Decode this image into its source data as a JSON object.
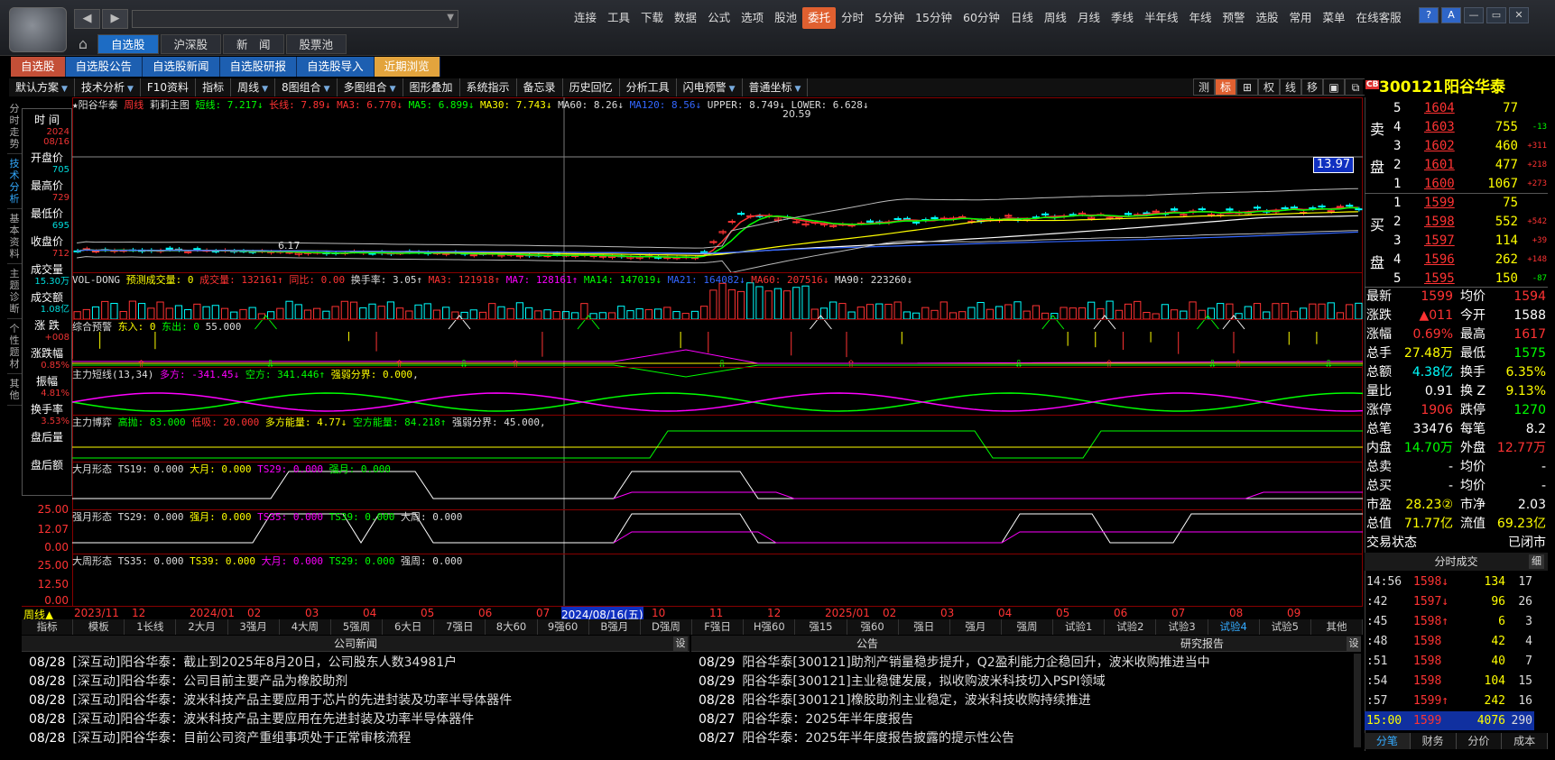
{
  "app": {
    "menu": [
      "连接",
      "工具",
      "下载",
      "数据",
      "公式",
      "选项",
      "股池",
      "委托",
      "分时",
      "5分钟",
      "15分钟",
      "60分钟",
      "日线",
      "周线",
      "月线",
      "季线",
      "半年线",
      "年线",
      "预警",
      "选股",
      "常用",
      "菜单",
      "在线客服"
    ],
    "highlighted_menu": "委托",
    "top_tabs": [
      "自选股",
      "沪深股",
      "新　闻",
      "股票池"
    ],
    "window_buttons": [
      "?",
      "A",
      "—",
      "▭",
      "✕"
    ]
  },
  "sub_tabs": [
    "自选股",
    "自选股公告",
    "自选股新闻",
    "自选股研报",
    "自选股导入",
    "近期浏览"
  ],
  "toolbar": [
    "默认方案",
    "技术分析",
    "F10资料",
    "指标",
    "周线",
    "8图组合",
    "多图组合",
    "图形叠加",
    "系统指示",
    "备忘录",
    "历史回忆",
    "分析工具",
    "闪电预警",
    "普通坐标"
  ],
  "right_tools": [
    "测",
    "标",
    "⊞",
    "权",
    "线",
    "移",
    "▣",
    "⧉"
  ],
  "vtabs": [
    "分时走势",
    "技术分析",
    "基本资料",
    "主题诊断",
    "个性题材",
    "其他"
  ],
  "info_panel": [
    {
      "label": "时 间",
      "values": [
        "2024",
        "08/16"
      ],
      "cyan": false
    },
    {
      "label": "开盘价",
      "values": [
        "705"
      ],
      "cyan": true
    },
    {
      "label": "最高价",
      "values": [
        "729"
      ],
      "cyan": false
    },
    {
      "label": "最低价",
      "values": [
        "695"
      ],
      "cyan": true
    },
    {
      "label": "收盘价",
      "values": [
        "712"
      ],
      "cyan": false
    },
    {
      "label": "成交量",
      "values": [
        "15.30万"
      ],
      "cyan": true
    },
    {
      "label": "成交额",
      "values": [
        "1.08亿"
      ],
      "cyan": true
    },
    {
      "label": "涨 跌",
      "values": [
        "+008"
      ],
      "cyan": false
    },
    {
      "label": "涨跌幅",
      "values": [
        "0.85%"
      ],
      "cyan": false
    },
    {
      "label": "振幅",
      "values": [
        "4.81%"
      ],
      "cyan": false
    },
    {
      "label": "换手率",
      "values": [
        "3.53%"
      ],
      "cyan": false
    },
    {
      "label": "盘后量",
      "values": [
        ""
      ],
      "cyan": false
    },
    {
      "label": "盘后额",
      "values": [
        ""
      ],
      "cyan": false
    }
  ],
  "panes": {
    "main": {
      "parts": [
        [
          "★阳谷华泰",
          "w"
        ],
        [
          " 周线 ",
          "r"
        ],
        [
          "莉莉主图 ",
          "w"
        ],
        [
          "短线: 7.217↓",
          "g"
        ],
        [
          " 长线: 7.89↓",
          "r"
        ],
        [
          " MA3: 6.770↓",
          "r"
        ],
        [
          " MA5: 6.899↓",
          "g"
        ],
        [
          " MA30: 7.743↓",
          "y"
        ],
        [
          " MA60: 8.26↓",
          "w"
        ],
        [
          " MA120: 8.56↓",
          "b"
        ],
        [
          " UPPER: 8.749↓",
          "w"
        ],
        [
          " LOWER: 6.628↓",
          "w"
        ]
      ],
      "high_label": "20.59",
      "low_label": "6.17",
      "price_tag": "13.97"
    },
    "vol": {
      "parts": [
        [
          "VOL-DONG ",
          "w"
        ],
        [
          "预测成交量: 0",
          "y"
        ],
        [
          " 成交量: 132161↑",
          "r"
        ],
        [
          " 同比: 0.00",
          "r"
        ],
        [
          " 换手率: 3.05↑",
          "w"
        ],
        [
          " MA3: 121918↑",
          "r"
        ],
        [
          " MA7: 128161↑",
          "m"
        ],
        [
          " MA14: 147019↓",
          "g"
        ],
        [
          " MA21: 164082↓",
          "b"
        ],
        [
          " MA60: 207516↓",
          "r"
        ],
        [
          " MA90: 223260↓",
          "w"
        ]
      ]
    },
    "warn": {
      "parts": [
        [
          "综合预警 ",
          "w"
        ],
        [
          "东入: 0",
          "y"
        ],
        [
          " 东出: 0",
          "g"
        ],
        [
          " 55.000",
          "w"
        ]
      ]
    },
    "zlsd": {
      "parts": [
        [
          "主力短线(13,34) ",
          "w"
        ],
        [
          "多方: -341.45↓",
          "m"
        ],
        [
          " 空方: 341.446↑",
          "g"
        ],
        [
          " 强弱分界: 0.000",
          "y"
        ],
        [
          ",",
          "w"
        ]
      ]
    },
    "zlby": {
      "parts": [
        [
          "主力博弈 ",
          "w"
        ],
        [
          "高抛: 83.000",
          "g"
        ],
        [
          " 低吸: 20.000",
          "r"
        ],
        [
          " 多方能量: 4.77↓",
          "y"
        ],
        [
          " 空方能量: 84.218↑",
          "g"
        ],
        [
          " 强弱分界: 45.000",
          "w"
        ],
        [
          ",",
          "w"
        ]
      ]
    },
    "dyxt": {
      "parts": [
        [
          "大月形态 ",
          "w"
        ],
        [
          "TS19: 0.000",
          "w"
        ],
        [
          " 大月: 0.000",
          "y"
        ],
        [
          " TS29: 0.000",
          "m"
        ],
        [
          " 强月: 0.000",
          "g"
        ]
      ]
    },
    "qyxt": {
      "parts": [
        [
          "强月形态 ",
          "w"
        ],
        [
          "TS29: 0.000",
          "w"
        ],
        [
          " 强月: 0.000",
          "y"
        ],
        [
          " TS35: 0.000",
          "m"
        ],
        [
          " TS39: 0.000",
          "g"
        ],
        [
          " 大周: 0.000",
          "w"
        ]
      ]
    },
    "dzxt": {
      "parts": [
        [
          "大周形态 ",
          "w"
        ],
        [
          "TS35: 0.000",
          "w"
        ],
        [
          " TS39: 0.000",
          "y"
        ],
        [
          " 大月: 0.000",
          "m"
        ],
        [
          " TS29: 0.000",
          "g"
        ],
        [
          " 强周: 0.000",
          "w"
        ]
      ]
    }
  },
  "y_axis_labels": {
    "p1": [
      "25.00",
      "12.07",
      "0.00"
    ],
    "p2": [
      "25.00",
      "12.50",
      "0.00"
    ]
  },
  "time_axis": {
    "period": "周线▲",
    "labels": [
      "2023/11",
      "12",
      "2024/01",
      "02",
      "03",
      "04",
      "05",
      "06",
      "07",
      "08",
      "10",
      "11",
      "12",
      "2025/01",
      "02",
      "03",
      "04",
      "05",
      "06",
      "07",
      "08",
      "09"
    ],
    "cursor": "2024/08/16(五)"
  },
  "bottom_tabs": [
    "指标",
    "模板",
    "1长线",
    "2大月",
    "3强月",
    "4大周",
    "5强周",
    "6大日",
    "7强日",
    "8大60",
    "9强60",
    "B强月",
    "D强周",
    "F强日",
    "H强60",
    "强15",
    "强60",
    "强日",
    "强月",
    "强周",
    "试验1",
    "试验2",
    "试验3",
    "试验4",
    "试验5",
    "其他"
  ],
  "news": {
    "left_title": "公司新闻",
    "mid_title": "公告",
    "right_title": "研究报告",
    "set_label": "设",
    "left": [
      {
        "date": "08/28",
        "text": "[深互动]阳谷华泰：截止到2025年8月20日，公司股东人数34981户"
      },
      {
        "date": "08/28",
        "text": "[深互动]阳谷华泰：公司目前主要产品为橡胶助剂"
      },
      {
        "date": "08/28",
        "text": "[深互动]阳谷华泰：波米科技产品主要应用于芯片的先进封装及功率半导体器件"
      },
      {
        "date": "08/28",
        "text": "[深互动]阳谷华泰：波米科技产品主要应用在先进封装及功率半导体器件"
      },
      {
        "date": "08/28",
        "text": "[深互动]阳谷华泰：目前公司资产重组事项处于正常审核流程"
      }
    ],
    "right": [
      {
        "date": "08/29",
        "text": "阳谷华泰[300121]助剂产销量稳步提升，Q2盈利能力企稳回升，波米收购推进当中"
      },
      {
        "date": "08/29",
        "text": "阳谷华泰[300121]主业稳健发展，拟收购波米科技切入PSPI领域"
      },
      {
        "date": "08/28",
        "text": "阳谷华泰[300121]橡胶助剂主业稳定，波米科技收购持续推进"
      },
      {
        "date": "08/27",
        "text": "阳谷华泰：2025年半年度报告"
      },
      {
        "date": "08/27",
        "text": "阳谷华泰：2025年半年度报告披露的提示性公告"
      }
    ]
  },
  "stock": {
    "badge": "CB",
    "code": "300121",
    "name": "阳谷华泰"
  },
  "orderbook": {
    "sell_label": [
      "卖",
      "盘"
    ],
    "buy_label": [
      "买",
      "盘"
    ],
    "asks": [
      {
        "lv": "5",
        "price": "1604",
        "qty": "77",
        "delta": ""
      },
      {
        "lv": "4",
        "price": "1603",
        "qty": "755",
        "delta": "-13"
      },
      {
        "lv": "3",
        "price": "1602",
        "qty": "460",
        "delta": "+311"
      },
      {
        "lv": "2",
        "price": "1601",
        "qty": "477",
        "delta": "+218"
      },
      {
        "lv": "1",
        "price": "1600",
        "qty": "1067",
        "delta": "+273"
      }
    ],
    "bids": [
      {
        "lv": "1",
        "price": "1599",
        "qty": "75",
        "delta": ""
      },
      {
        "lv": "2",
        "price": "1598",
        "qty": "552",
        "delta": "+542"
      },
      {
        "lv": "3",
        "price": "1597",
        "qty": "114",
        "delta": "+39"
      },
      {
        "lv": "4",
        "price": "1596",
        "qty": "262",
        "delta": "+148"
      },
      {
        "lv": "5",
        "price": "1595",
        "qty": "150",
        "delta": "-87"
      }
    ]
  },
  "quotes": [
    {
      "k": "最新",
      "v": "1599",
      "vc": "#f33",
      "k2": "均价",
      "v2": "1594",
      "v2c": "#f33"
    },
    {
      "k": "涨跌",
      "v": "▲011",
      "vc": "#f33",
      "k2": "今开",
      "v2": "1588",
      "v2c": "#fff"
    },
    {
      "k": "涨幅",
      "v": "0.69%",
      "vc": "#f33",
      "k2": "最高",
      "v2": "1617",
      "v2c": "#f33"
    },
    {
      "k": "总手",
      "v": "27.48万",
      "vc": "#ff0",
      "k2": "最低",
      "v2": "1575",
      "v2c": "#0f0"
    },
    {
      "k": "总额",
      "v": "4.38亿",
      "vc": "#0ff",
      "k2": "换手",
      "v2": "6.35%",
      "v2c": "#ff0"
    },
    {
      "k": "量比",
      "v": "0.91",
      "vc": "#fff",
      "k2": "换 Z",
      "v2": "9.13%",
      "v2c": "#ff0"
    },
    {
      "k": "涨停",
      "v": "1906",
      "vc": "#f33",
      "k2": "跌停",
      "v2": "1270",
      "v2c": "#0f0"
    },
    {
      "k": "总笔",
      "v": "33476",
      "vc": "#fff",
      "k2": "每笔",
      "v2": "8.2",
      "v2c": "#fff"
    },
    {
      "k": "内盘",
      "v": "14.70万",
      "vc": "#0f0",
      "k2": "外盘",
      "v2": "12.77万",
      "v2c": "#f33"
    },
    {
      "k": "总卖",
      "v": "-",
      "vc": "#fff",
      "k2": "均价",
      "v2": "-",
      "v2c": "#fff"
    },
    {
      "k": "总买",
      "v": "-",
      "vc": "#fff",
      "k2": "均价",
      "v2": "-",
      "v2c": "#fff"
    },
    {
      "k": "市盈",
      "v": "28.23②",
      "vc": "#ff0",
      "k2": "市净",
      "v2": "2.03",
      "v2c": "#fff"
    },
    {
      "k": "总值",
      "v": "71.77亿",
      "vc": "#ff0",
      "k2": "流值",
      "v2": "69.23亿",
      "v2c": "#ff0"
    },
    {
      "k": "交易状态",
      "v": "",
      "vc": "#fff",
      "k2": "",
      "v2": "已闭市",
      "v2c": "#fff"
    }
  ],
  "ticks": {
    "title": "分时成交",
    "toggle": "细",
    "rows": [
      {
        "t": "14:56",
        "p": "1598↓",
        "q": "134",
        "n": "17"
      },
      {
        "t": "  :42",
        "p": "1597↓",
        "q": "96",
        "n": "26"
      },
      {
        "t": "  :45",
        "p": "1598↑",
        "q": "6",
        "n": "3"
      },
      {
        "t": "  :48",
        "p": "1598",
        "q": "42",
        "n": "4"
      },
      {
        "t": "  :51",
        "p": "1598",
        "q": "40",
        "n": "7"
      },
      {
        "t": "  :54",
        "p": "1598",
        "q": "104",
        "n": "15"
      },
      {
        "t": "  :57",
        "p": "1599↑",
        "q": "242",
        "n": "16"
      },
      {
        "t": "15:00",
        "p": "1599",
        "q": "4076",
        "n": "290"
      }
    ]
  },
  "right_tabs": [
    "分笔",
    "财务",
    "分价",
    "成本"
  ]
}
